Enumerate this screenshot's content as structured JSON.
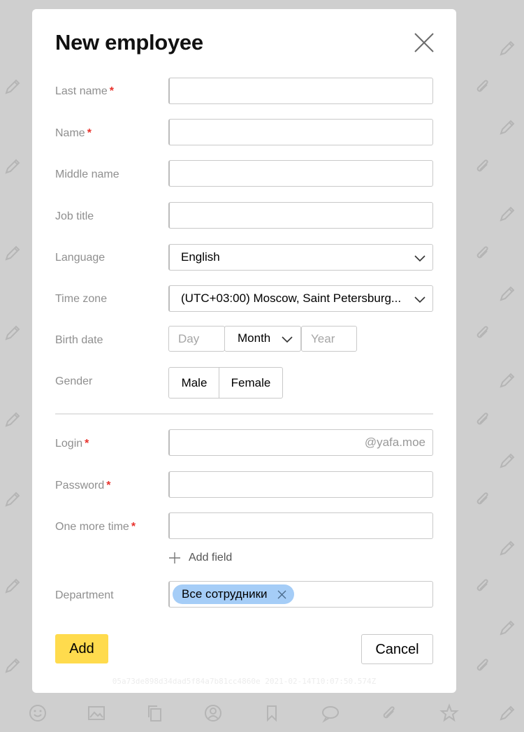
{
  "background_icons": [
    "smile-icon",
    "image-icon",
    "copy-icon",
    "user-icon",
    "bookmark-icon",
    "comment-icon",
    "paperclip-icon",
    "star-icon",
    "pencil-icon"
  ],
  "modal": {
    "title": "New employee",
    "close_icon": "close-icon"
  },
  "form": {
    "last_name": {
      "label": "Last name",
      "required_mark": "*",
      "value": ""
    },
    "name": {
      "label": "Name",
      "required_mark": "*",
      "value": ""
    },
    "middle_name": {
      "label": "Middle name",
      "value": ""
    },
    "job_title": {
      "label": "Job title",
      "value": ""
    },
    "language": {
      "label": "Language",
      "selected": "English"
    },
    "time_zone": {
      "label": "Time zone",
      "selected": "(UTC+03:00) Moscow, Saint Petersburg..."
    },
    "birth_date": {
      "label": "Birth date",
      "day_placeholder": "Day",
      "month_selected": "Month",
      "year_placeholder": "Year"
    },
    "gender": {
      "label": "Gender",
      "options": [
        "Male",
        "Female"
      ]
    },
    "login": {
      "label": "Login",
      "required_mark": "*",
      "value": "",
      "suffix": "@yafa.moe"
    },
    "password": {
      "label": "Password",
      "required_mark": "*",
      "value": ""
    },
    "password_repeat": {
      "label": "One more time",
      "required_mark": "*",
      "value": ""
    },
    "add_field_label": "Add field",
    "department": {
      "label": "Department",
      "chips": [
        "Все сотрудники"
      ]
    }
  },
  "actions": {
    "add_label": "Add",
    "cancel_label": "Cancel"
  },
  "footer_meta": "05a73de898d34dad5f84a7b81cc4860e 2021-02-14T10:07:50.574Z",
  "colors": {
    "accent_button": "#ffdb4d",
    "chip": "#a5cdf7",
    "required": "#e8322c",
    "overlay": "#cfcfcf"
  }
}
